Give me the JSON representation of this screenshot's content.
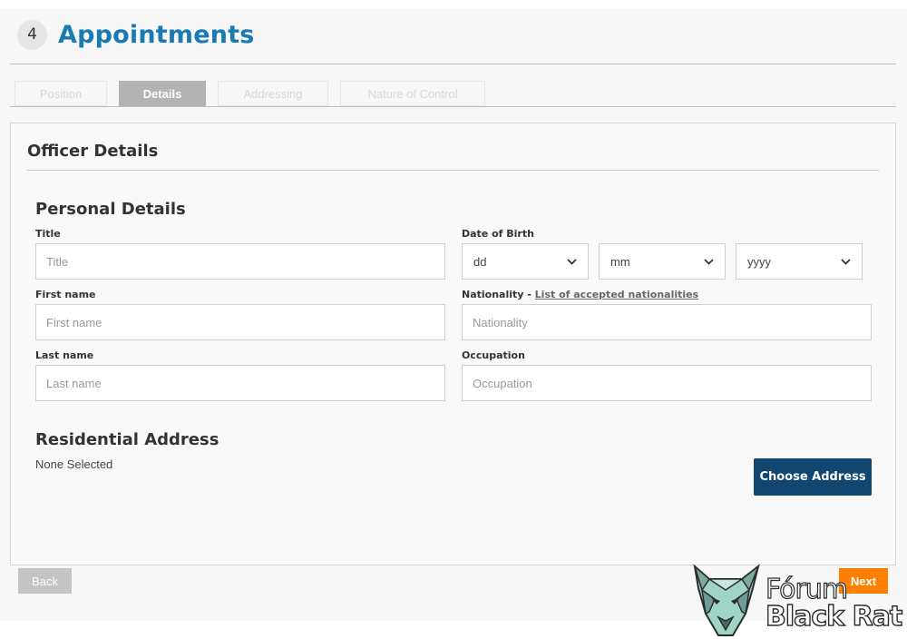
{
  "header": {
    "step_number": "4",
    "title": "Appointments"
  },
  "tabs": [
    {
      "label": "Position",
      "active": false
    },
    {
      "label": "Details",
      "active": true
    },
    {
      "label": "Addressing",
      "active": false
    },
    {
      "label": "Nature of Control",
      "active": false
    }
  ],
  "panel": {
    "title": "Officer Details"
  },
  "personal_details": {
    "heading": "Personal Details",
    "title_field": {
      "label": "Title",
      "placeholder": "Title"
    },
    "first_name_field": {
      "label": "First name",
      "placeholder": "First name"
    },
    "last_name_field": {
      "label": "Last name",
      "placeholder": "Last name"
    },
    "dob": {
      "label": "Date of Birth",
      "day": "dd",
      "month": "mm",
      "year": "yyyy"
    },
    "nationality_field": {
      "label": "Nationality - ",
      "link": "List of accepted nationalities",
      "placeholder": "Nationality"
    },
    "occupation_field": {
      "label": "Occupation",
      "placeholder": "Occupation"
    }
  },
  "residential_address": {
    "heading": "Residential Address",
    "status": "None Selected",
    "choose_button": "Choose Address"
  },
  "footer": {
    "back_label": "Back",
    "next_label": "Next"
  },
  "watermark": {
    "line1": "Fórum",
    "line2": "Black Rat"
  },
  "colors": {
    "title_blue": "#1a7bb2",
    "button_navy": "#10466f",
    "next_orange": "#ff7f00"
  }
}
